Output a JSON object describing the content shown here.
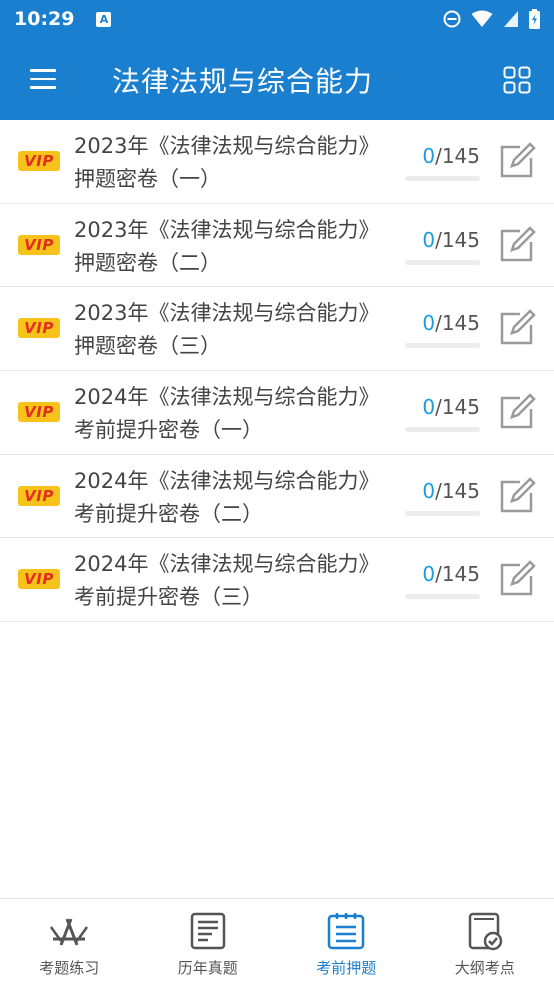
{
  "status": {
    "time": "10:29",
    "notif_icon": "A"
  },
  "header": {
    "title": "法律法规与综合能力"
  },
  "papers": [
    {
      "title": "2023年《法律法规与综合能力》押题密卷（一）",
      "done": "0",
      "total": "/145",
      "progress": 0
    },
    {
      "title": "2023年《法律法规与综合能力》押题密卷（二）",
      "done": "0",
      "total": "/145",
      "progress": 0
    },
    {
      "title": "2023年《法律法规与综合能力》押题密卷（三）",
      "done": "0",
      "total": "/145",
      "progress": 0
    },
    {
      "title": "2024年《法律法规与综合能力》考前提升密卷（一）",
      "done": "0",
      "total": "/145",
      "progress": 0
    },
    {
      "title": "2024年《法律法规与综合能力》考前提升密卷（二）",
      "done": "0",
      "total": "/145",
      "progress": 0
    },
    {
      "title": "2024年《法律法规与综合能力》考前提升密卷（三）",
      "done": "0",
      "total": "/145",
      "progress": 0
    }
  ],
  "vip_label": "VIP",
  "tabs": [
    {
      "label": "考题练习",
      "icon": "practice-icon",
      "active": false
    },
    {
      "label": "历年真题",
      "icon": "past-papers-icon",
      "active": false
    },
    {
      "label": "考前押题",
      "icon": "prediction-icon",
      "active": true
    },
    {
      "label": "大纲考点",
      "icon": "syllabus-icon",
      "active": false
    }
  ],
  "colors": {
    "primary": "#1a7fcf",
    "accent": "#1a9de0",
    "vip_bg": "#f7c21a",
    "vip_text": "#e0301e"
  }
}
